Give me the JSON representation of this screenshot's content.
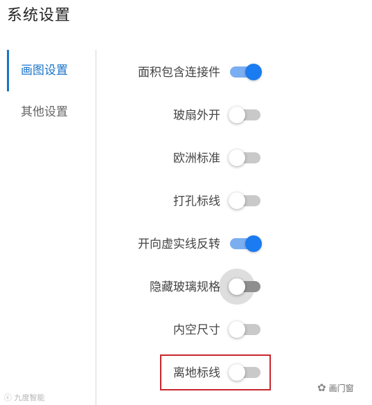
{
  "page": {
    "title": "系统设置"
  },
  "sidebar": {
    "items": [
      {
        "label": "画图设置",
        "active": true
      },
      {
        "label": "其他设置",
        "active": false
      }
    ]
  },
  "settings": [
    {
      "label": "面积包含连接件",
      "on": true
    },
    {
      "label": "玻扇外开",
      "on": false
    },
    {
      "label": "欧洲标准",
      "on": false
    },
    {
      "label": "打孔标线",
      "on": false
    },
    {
      "label": "开向虚实线反转",
      "on": true
    },
    {
      "label": "隐藏玻璃规格",
      "on": false
    },
    {
      "label": "内空尺寸",
      "on": false
    },
    {
      "label": "离地标线",
      "on": false
    }
  ],
  "watermarks": {
    "left": "ⓒ 九度智能",
    "right_icon": "wechat-icon",
    "right": "画门窗"
  },
  "colors": {
    "accent": "#1a73c8",
    "toggle_on": "#1b7bf0",
    "toggle_on_track": "#7aaef0",
    "toggle_off_track": "#c9c9c9",
    "highlight": "#c8262c"
  }
}
